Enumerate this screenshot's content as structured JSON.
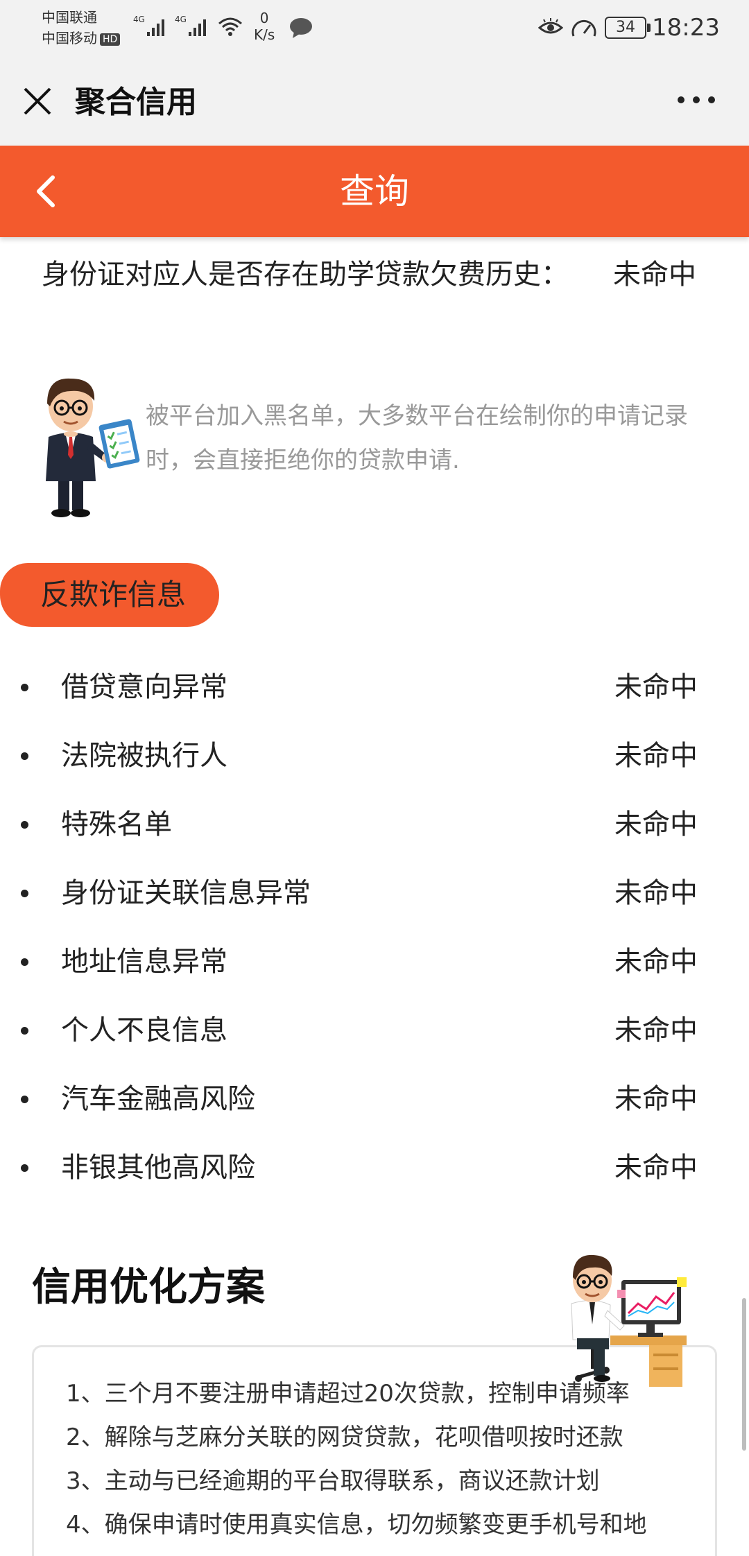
{
  "status_bar": {
    "carrier_1": "中国联通",
    "carrier_2": "中国移动",
    "hd_badge": "HD",
    "network_1": "4G",
    "network_2": "4G",
    "net_speed_value": "0",
    "net_speed_unit": "K/s",
    "battery": "34",
    "time": "18:23"
  },
  "app_bar": {
    "title": "聚合信用"
  },
  "nav": {
    "title": "查询"
  },
  "query": {
    "label": "身份证对应人是否存在助学贷款欠费历史：",
    "value": "未命中"
  },
  "tip": {
    "text": "被平台加入黑名单，大多数平台在绘制你的申请记录时，会直接拒绝你的贷款申请."
  },
  "anti_fraud": {
    "title": "反欺诈信息",
    "items": [
      {
        "label": "借贷意向异常",
        "value": "未命中"
      },
      {
        "label": "法院被执行人",
        "value": "未命中"
      },
      {
        "label": "特殊名单",
        "value": "未命中"
      },
      {
        "label": "身份证关联信息异常",
        "value": "未命中"
      },
      {
        "label": "地址信息异常",
        "value": "未命中"
      },
      {
        "label": "个人不良信息",
        "value": "未命中"
      },
      {
        "label": "汽车金融高风险",
        "value": "未命中"
      },
      {
        "label": "非银其他高风险",
        "value": "未命中"
      }
    ]
  },
  "plan": {
    "title": "信用优化方案",
    "items": [
      "1、三个月不要注册申请超过20次贷款，控制申请频率",
      "2、解除与芝麻分关联的网贷贷款，花呗借呗按时还款",
      "3、主动与已经逾期的平台取得联系，商议还款计划",
      "4、确保申请时使用真实信息，切勿频繁变更手机号和地"
    ]
  },
  "colors": {
    "brand": "#f35a2d",
    "tip_text": "#999999",
    "background": "#ffffff"
  }
}
